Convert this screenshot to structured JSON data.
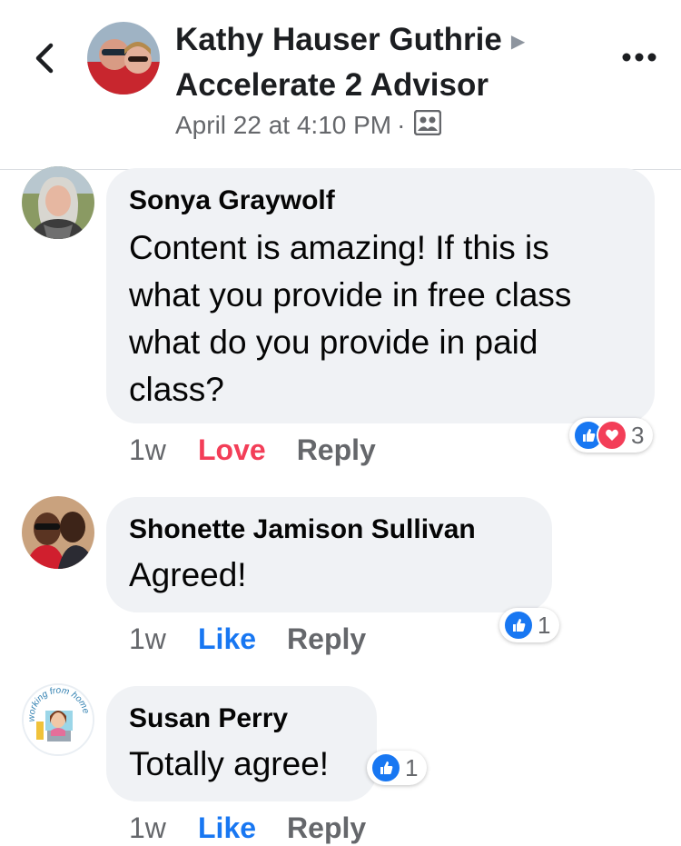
{
  "header": {
    "title_line1": "Kathy Hauser Guthrie",
    "title_line2": "Accelerate 2 Advisor",
    "date": "April 22 at 4:10 PM",
    "separator": "·"
  },
  "comments": [
    {
      "author": "Sonya Graywolf",
      "text_lines": [
        "Content is amazing! If this is",
        "what you provide in free class",
        "what do you provide in paid",
        "class?"
      ],
      "time": "1w",
      "reaction_action": "Love",
      "reply": "Reply",
      "reaction_count": "3",
      "reaction_types": [
        "like",
        "love"
      ]
    },
    {
      "author": "Shonette Jamison Sullivan",
      "text_lines": [
        "Agreed!"
      ],
      "time": "1w",
      "reaction_action": "Like",
      "reply": "Reply",
      "reaction_count": "1",
      "reaction_types": [
        "like"
      ]
    },
    {
      "author": "Susan Perry",
      "text_lines": [
        "Totally agree!"
      ],
      "time": "1w",
      "reaction_action": "Like",
      "reply": "Reply",
      "reaction_count": "1",
      "reaction_types": [
        "like"
      ],
      "avatar_text": "working from home"
    }
  ],
  "colors": {
    "like_blue": "#1877f2",
    "love_red": "#f33e58",
    "bubble_gray": "#f0f2f5",
    "meta_gray": "#65676b"
  },
  "icons": {
    "back": "chevron-left-icon",
    "more": "more-dots-icon",
    "audience": "group-audience-icon"
  }
}
